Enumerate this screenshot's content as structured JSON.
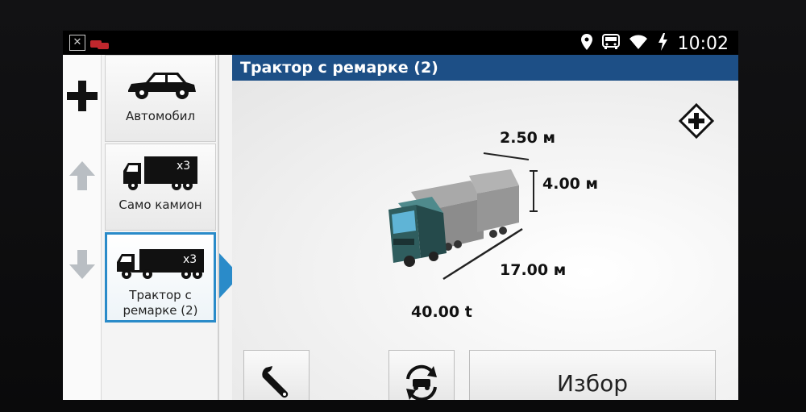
{
  "status": {
    "time": "10:02",
    "icons": [
      "close-x-icon",
      "notification-icon",
      "location-icon",
      "vehicle-icon",
      "wifi-icon",
      "battery-charging-icon"
    ]
  },
  "header": {
    "title": "Трактор с ремарке (2)"
  },
  "rail": {
    "icons": [
      "plus-icon",
      "arrow-up-icon",
      "arrow-down-icon"
    ]
  },
  "profiles": [
    {
      "label": "Автомобил",
      "icon": "car-icon"
    },
    {
      "label": "Само камион",
      "icon": "truck-icon",
      "badge": "x3"
    },
    {
      "label": "Трактор с ремарке (2)",
      "icon": "tractor-trailer-icon",
      "badge": "x3",
      "selected": true
    }
  ],
  "vehicle": {
    "width": "2.50 м",
    "height": "4.00 м",
    "length": "17.00 м",
    "weight": "40.00  t"
  },
  "buttons": {
    "select_label": "Избор",
    "settings_icon": "wrench-icon",
    "switch_icon": "vehicle-switch-icon"
  },
  "colors": {
    "title_bar": "#1d4f86",
    "selection": "#2a8bc9",
    "truck_cab": "#2f5d5e"
  }
}
